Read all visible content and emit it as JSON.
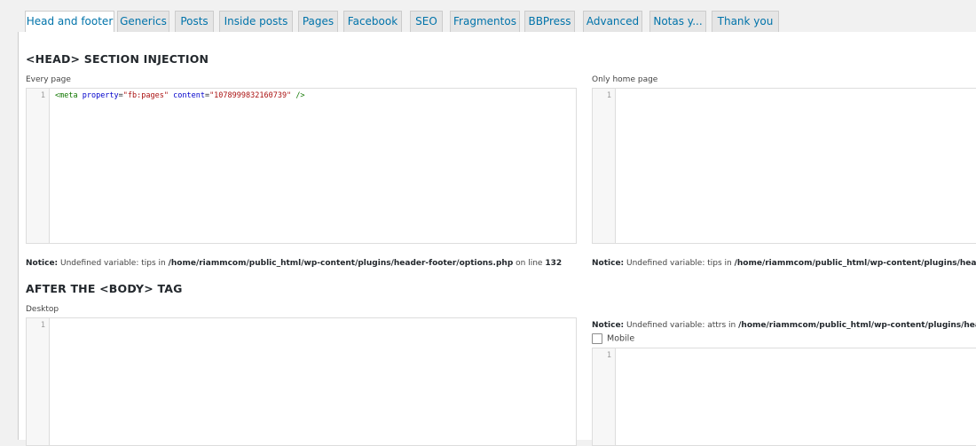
{
  "tabs": [
    {
      "label": "Head and footer",
      "active": true
    },
    {
      "label": "Generics"
    },
    {
      "label": "Posts"
    },
    {
      "label": "Inside posts"
    },
    {
      "label": "Pages"
    },
    {
      "label": "Facebook"
    },
    {
      "label": "SEO"
    },
    {
      "label": "Fragmentos"
    },
    {
      "label": "BBPress"
    },
    {
      "label": "Advanced"
    },
    {
      "label": "Notas y..."
    },
    {
      "label": "Thank you"
    }
  ],
  "head_section": {
    "title": "<HEAD> SECTION INJECTION",
    "every_page": {
      "label": "Every page",
      "line_number": "1",
      "code": {
        "open": "<meta",
        "attr1": "property",
        "eq1": "=",
        "val1": "\"fb:pages\"",
        "attr2": "content",
        "eq2": "=",
        "val2": "\"1078999832160739\"",
        "close": "/>"
      }
    },
    "only_home": {
      "label": "Only home page",
      "line_number": "1"
    },
    "notice_left": {
      "prefix": "Notice:",
      "text1": " Undefined variable: tips in ",
      "path": "/home/riammcom/public_html/wp-content/plugins/header-footer/options.php",
      "text2": " on line ",
      "line": "132"
    },
    "notice_right": {
      "prefix": "Notice:",
      "text1": " Undefined variable: tips in ",
      "path": "/home/riammcom/public_html/wp-content/plugins/heade"
    }
  },
  "body_section": {
    "title": "AFTER THE <BODY> TAG",
    "desktop": {
      "label": "Desktop",
      "line_number": "1"
    },
    "notice_right": {
      "prefix": "Notice:",
      "text1": " Undefined variable: attrs in ",
      "path": "/home/riammcom/public_html/wp-content/plugins/head"
    },
    "mobile": {
      "label": "Mobile",
      "checked": false,
      "line_number": "1"
    }
  },
  "colors": {
    "link": "#0073aa",
    "tag": "#117700",
    "attr": "#0000cc",
    "string": "#aa1111"
  }
}
